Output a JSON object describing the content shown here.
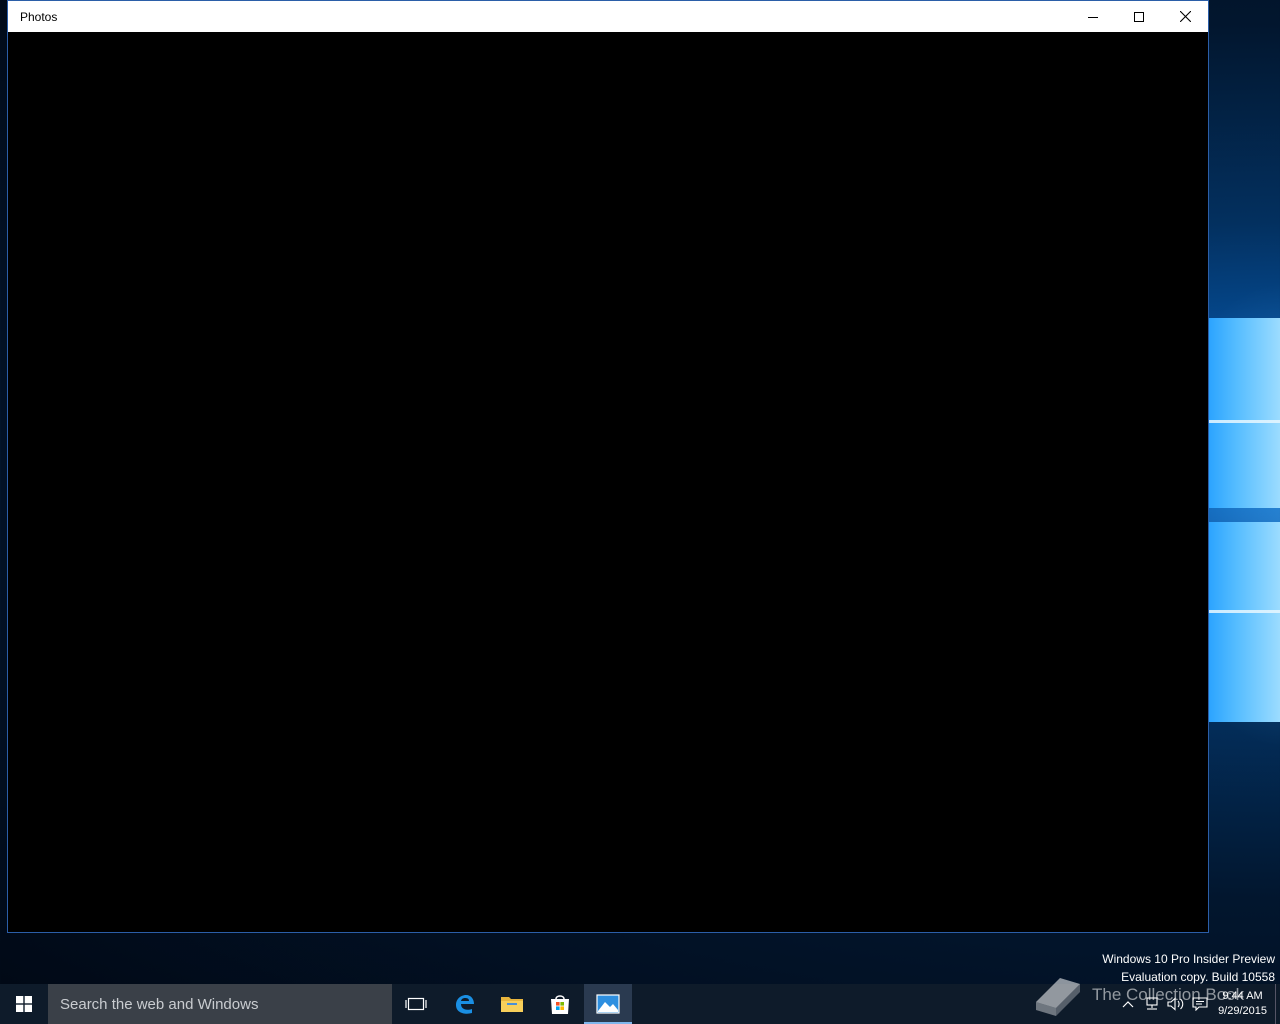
{
  "window": {
    "title": "Photos",
    "controls": {
      "minimize_icon": "minimize-icon",
      "maximize_icon": "maximize-icon",
      "close_icon": "close-icon"
    }
  },
  "desktop": {
    "watermark_line1": "Windows 10 Pro Insider Preview",
    "watermark_line2": "Evaluation copy. Build 10558",
    "overlay_watermark": "The Collection Book"
  },
  "taskbar": {
    "search_placeholder": "Search the web and Windows",
    "pinned": [
      {
        "name": "task-view-icon"
      },
      {
        "name": "edge-icon"
      },
      {
        "name": "file-explorer-icon"
      },
      {
        "name": "store-icon"
      },
      {
        "name": "photos-icon",
        "active": true
      }
    ],
    "tray": {
      "time": "9:44 AM",
      "date": "9/29/2015"
    }
  },
  "colors": {
    "taskbar_bg": "#0e1b2a",
    "search_bg": "#3a4048",
    "window_border": "#2b5ea8",
    "accent": "#7fb6ec"
  }
}
